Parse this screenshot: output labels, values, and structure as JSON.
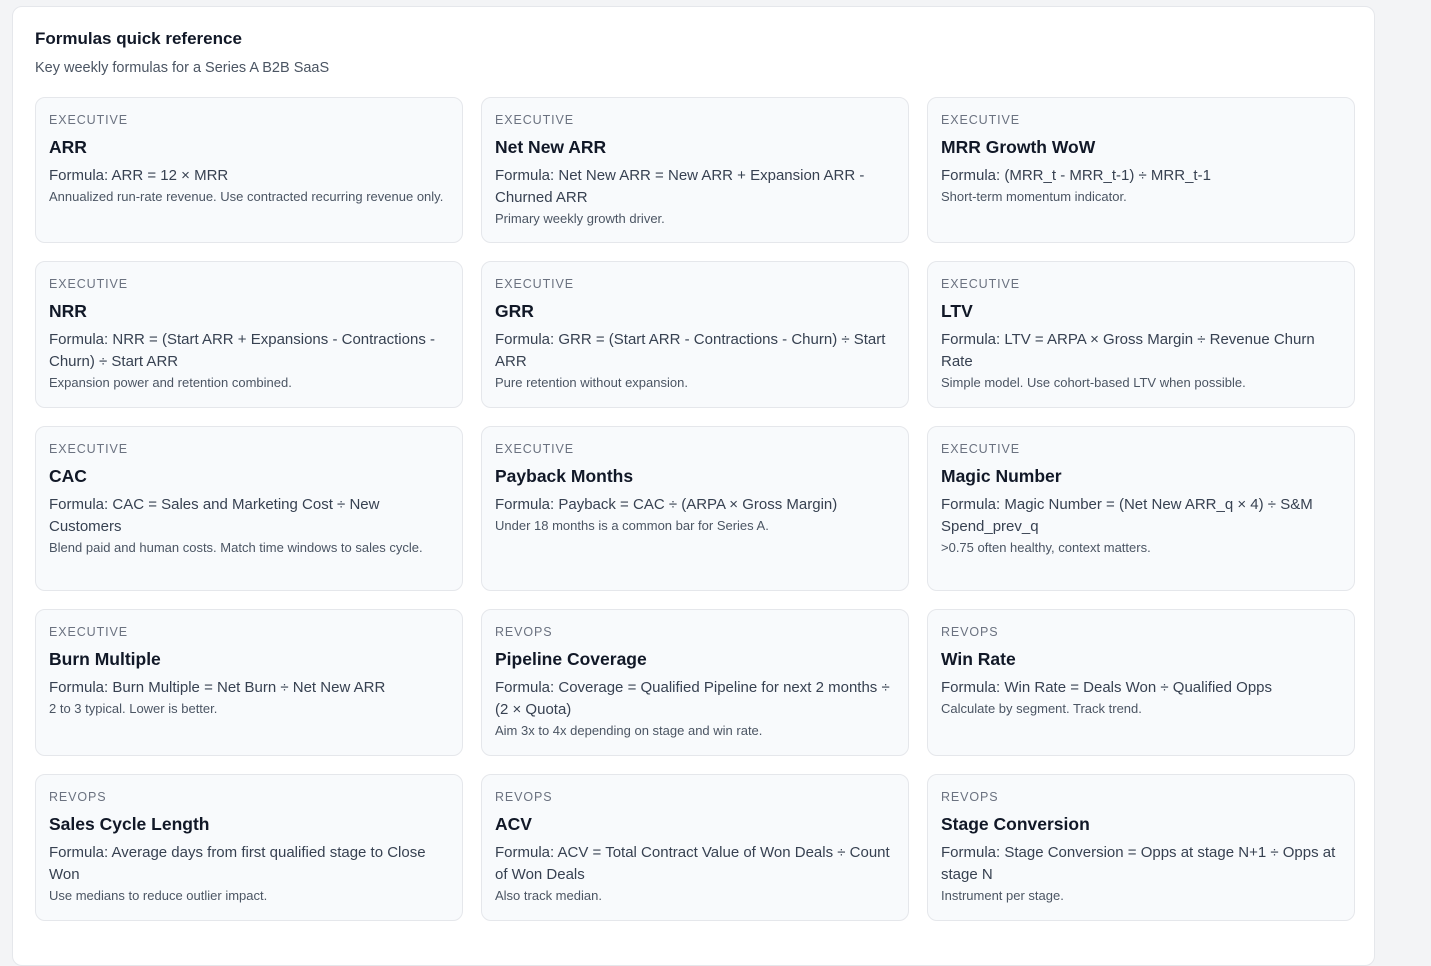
{
  "header": {
    "title": "Formulas quick reference",
    "subtitle": "Key weekly formulas for a Series A B2B SaaS"
  },
  "formula_label": "Formula:",
  "cards": [
    {
      "category": "EXECUTIVE",
      "name": "ARR",
      "formula": "ARR = 12 × MRR",
      "note": "Annualized run-rate revenue. Use contracted recurring revenue only."
    },
    {
      "category": "EXECUTIVE",
      "name": "Net New ARR",
      "formula": "Net New ARR = New ARR + Expansion ARR - Churned ARR",
      "note": "Primary weekly growth driver."
    },
    {
      "category": "EXECUTIVE",
      "name": "MRR Growth WoW",
      "formula": "(MRR_t - MRR_t-1) ÷ MRR_t-1",
      "note": "Short-term momentum indicator."
    },
    {
      "category": "EXECUTIVE",
      "name": "NRR",
      "formula": "NRR = (Start ARR + Expansions - Contractions - Churn) ÷ Start ARR",
      "note": "Expansion power and retention combined."
    },
    {
      "category": "EXECUTIVE",
      "name": "GRR",
      "formula": "GRR = (Start ARR - Contractions - Churn) ÷ Start ARR",
      "note": "Pure retention without expansion."
    },
    {
      "category": "EXECUTIVE",
      "name": "LTV",
      "formula": "LTV = ARPA × Gross Margin ÷ Revenue Churn Rate",
      "note": "Simple model. Use cohort-based LTV when possible."
    },
    {
      "category": "EXECUTIVE",
      "name": "CAC",
      "formula": "CAC = Sales and Marketing Cost ÷ New Customers",
      "note": "Blend paid and human costs. Match time windows to sales cycle."
    },
    {
      "category": "EXECUTIVE",
      "name": "Payback Months",
      "formula": "Payback = CAC ÷ (ARPA × Gross Margin)",
      "note": "Under 18 months is a common bar for Series A."
    },
    {
      "category": "EXECUTIVE",
      "name": "Magic Number",
      "formula": "Magic Number = (Net New ARR_q × 4) ÷ S&M Spend_prev_q",
      "note": ">0.75 often healthy, context matters."
    },
    {
      "category": "EXECUTIVE",
      "name": "Burn Multiple",
      "formula": "Burn Multiple = Net Burn ÷ Net New ARR",
      "note": "2 to 3 typical. Lower is better."
    },
    {
      "category": "REVOPS",
      "name": "Pipeline Coverage",
      "formula": "Coverage = Qualified Pipeline for next 2 months ÷ (2 × Quota)",
      "note": "Aim 3x to 4x depending on stage and win rate."
    },
    {
      "category": "REVOPS",
      "name": "Win Rate",
      "formula": "Win Rate = Deals Won ÷ Qualified Opps",
      "note": "Calculate by segment. Track trend."
    },
    {
      "category": "REVOPS",
      "name": "Sales Cycle Length",
      "formula": "Average days from first qualified stage to Close Won",
      "note": "Use medians to reduce outlier impact."
    },
    {
      "category": "REVOPS",
      "name": "ACV",
      "formula": "ACV = Total Contract Value of Won Deals ÷ Count of Won Deals",
      "note": "Also track median."
    },
    {
      "category": "REVOPS",
      "name": "Stage Conversion",
      "formula": "Stage Conversion = Opps at stage N+1 ÷ Opps at stage N",
      "note": "Instrument per stage."
    }
  ]
}
